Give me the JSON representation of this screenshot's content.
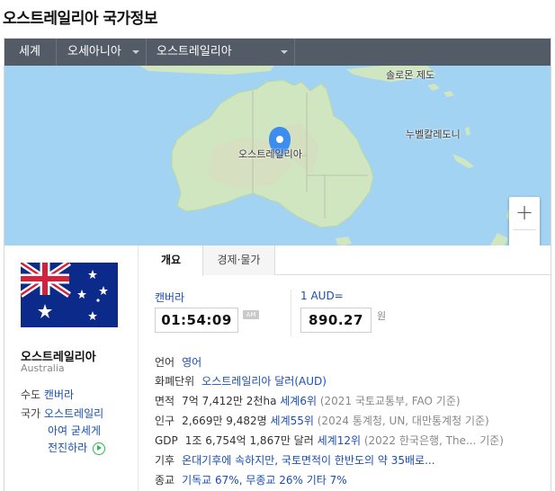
{
  "page": {
    "title": "오스트레일리아 국가정보"
  },
  "nav": {
    "world": "세계",
    "region": "오세아니아",
    "country": "오스트레일리아"
  },
  "map": {
    "solomon": "솔로몬 제도",
    "new_caledonia": "누벨칼레도니",
    "australia": "오스트레일리아",
    "zoom_in": "+",
    "zoom_out": "—"
  },
  "sidebar": {
    "name": "오스트레일리아",
    "name_en": "Australia",
    "capital_key": "수도",
    "capital_val": "캔버라",
    "anthem_key": "국가",
    "anthem_line1": "오스트레일리",
    "anthem_line2": "아여 굳세게",
    "anthem_line3": "전진하라"
  },
  "tabs": {
    "overview": "개요",
    "economy": "경제·물가"
  },
  "widgets": {
    "city": "캔버라",
    "time": "01:54:09",
    "ampm": "AM",
    "currency_label": "1 AUD=",
    "rate": "890.27",
    "unit": "원"
  },
  "info": {
    "lang_k": "언어",
    "lang_v": "영어",
    "cur_k": "화폐단위",
    "cur_v": "오스트레일리아 달러(AUD)",
    "area_k": "면적",
    "area_v": "7억 7,412만 2천ha",
    "area_rank": "세계6위",
    "area_src": "(2021 국토교통부, FAO 기준)",
    "pop_k": "인구",
    "pop_v": "2,669만 9,482명",
    "pop_rank": "세계55위",
    "pop_src": "(2024 통계청, UN, 대만통계청 기준)",
    "gdp_k": "GDP",
    "gdp_v": "1조 6,754억 1,867만 달러",
    "gdp_rank": "세계12위",
    "gdp_src": "(2022 한국은행, The... 기준)",
    "clim_k": "기후",
    "clim_v": "온대기후에 속하지만, 국토면적이 한반도의 약 35배로...",
    "rel_k": "종교",
    "rel_v": "기독교 67%, 무종교 26% 기타 7%"
  },
  "colors": {
    "nav_bg": "#525b66",
    "link": "#1a4fb4",
    "ocean": "#a3d3f2",
    "land": "#cfe6c0",
    "pin": "#3d8df0"
  }
}
